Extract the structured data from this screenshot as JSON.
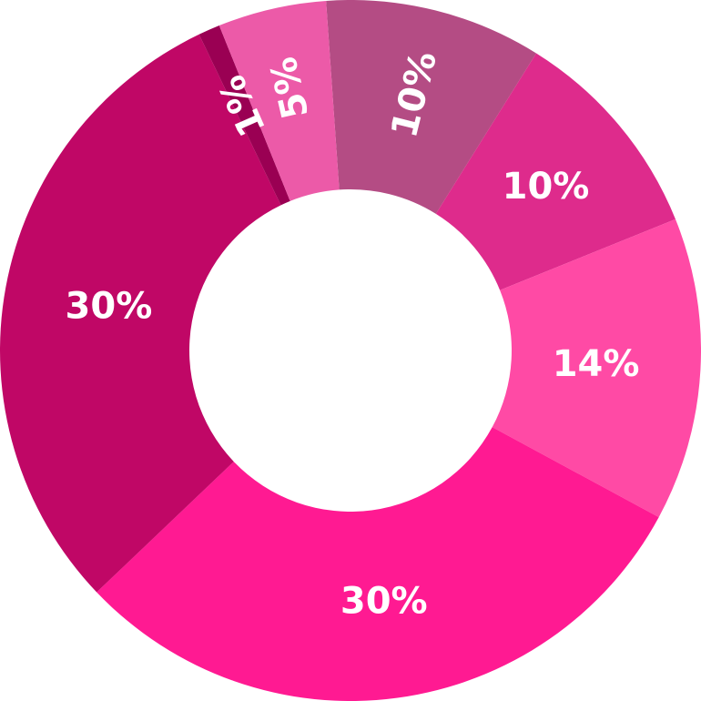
{
  "chart_data": {
    "type": "pie",
    "donut": true,
    "categories": [
      "",
      "",
      "",
      "",
      "",
      "",
      ""
    ],
    "values": [
      10,
      10,
      14,
      30,
      30,
      1,
      5
    ],
    "labels": [
      "10%",
      "10%",
      "14%",
      "30%",
      "30%",
      "1%",
      "5%"
    ],
    "colors": [
      "#b44c84",
      "#de2b8c",
      "#ff4aa5",
      "#ff1a92",
      "#c00766",
      "#9a0053",
      "#ec5aa8"
    ],
    "title": "",
    "legend": "none"
  }
}
